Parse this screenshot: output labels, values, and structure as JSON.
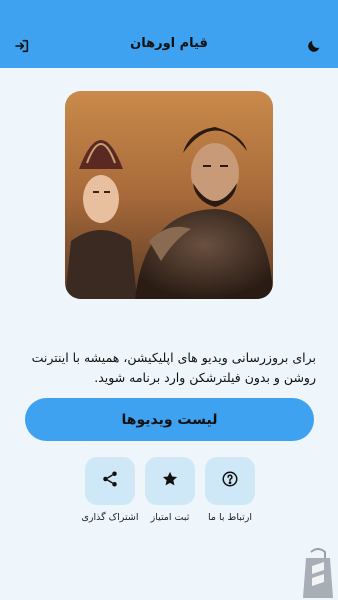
{
  "appbar": {
    "title": "قیام اورهان",
    "left_icon": "exit-icon",
    "right_icon": "moon-icon"
  },
  "hero": {
    "image": "two-characters-portrait"
  },
  "description": "برای بروزرسانی ویدیو های اپلیکیشن، همیشه با اینترنت روشن و بدون فیلترشکن وارد برنامه شوید.",
  "primary_button": "لیست ویدیوها",
  "actions": [
    {
      "icon": "question-icon",
      "label": "ارتباط با ما"
    },
    {
      "icon": "star-icon",
      "label": "ثبت امتیاز"
    },
    {
      "icon": "share-icon",
      "label": "اشتراک گذاری"
    }
  ],
  "colors": {
    "accent": "#3ea2f0",
    "background": "#eef6fb",
    "tile": "#cfe8f8"
  }
}
